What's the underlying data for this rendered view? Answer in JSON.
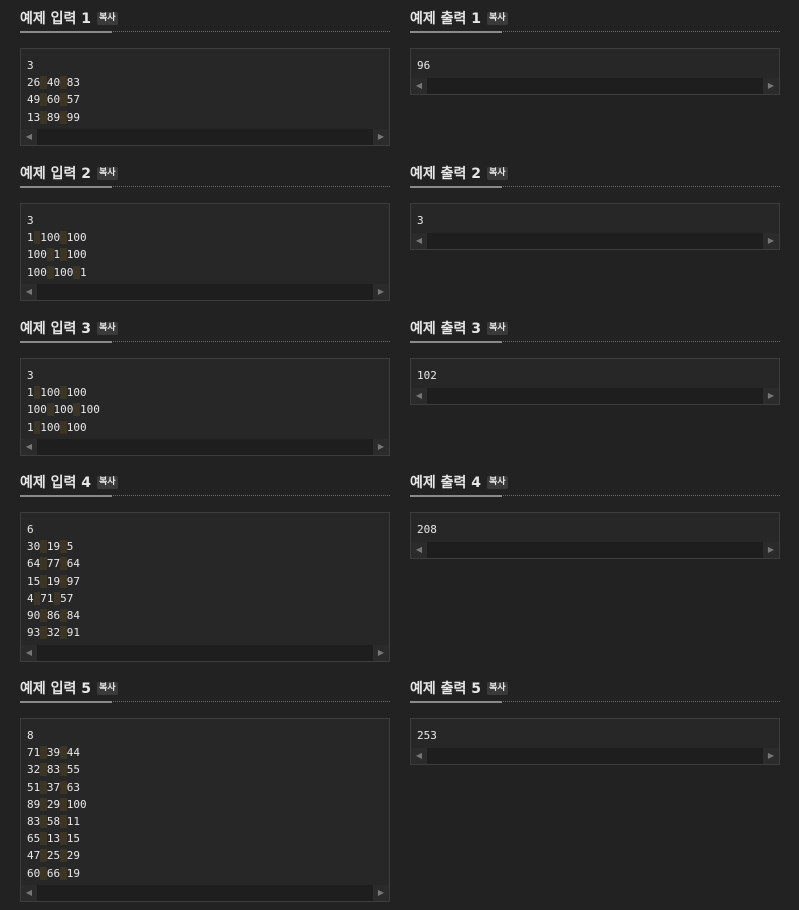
{
  "copy_label": "복사",
  "samples": [
    {
      "input_title": "예제 입력 1",
      "output_title": "예제 출력 1",
      "input_lines": [
        "3",
        [
          "26",
          "40",
          "83"
        ],
        [
          "49",
          "60",
          "57"
        ],
        [
          "13",
          "89",
          "99"
        ]
      ],
      "output": "96"
    },
    {
      "input_title": "예제 입력 2",
      "output_title": "예제 출력 2",
      "input_lines": [
        "3",
        [
          "1",
          "100",
          "100"
        ],
        [
          "100",
          "1",
          "100"
        ],
        [
          "100",
          "100",
          "1"
        ]
      ],
      "output": "3"
    },
    {
      "input_title": "예제 입력 3",
      "output_title": "예제 출력 3",
      "input_lines": [
        "3",
        [
          "1",
          "100",
          "100"
        ],
        [
          "100",
          "100",
          "100"
        ],
        [
          "1",
          "100",
          "100"
        ]
      ],
      "output": "102"
    },
    {
      "input_title": "예제 입력 4",
      "output_title": "예제 출력 4",
      "input_lines": [
        "6",
        [
          "30",
          "19",
          "5"
        ],
        [
          "64",
          "77",
          "64"
        ],
        [
          "15",
          "19",
          "97"
        ],
        [
          "4",
          "71",
          "57"
        ],
        [
          "90",
          "86",
          "84"
        ],
        [
          "93",
          "32",
          "91"
        ]
      ],
      "output": "208"
    },
    {
      "input_title": "예제 입력 5",
      "output_title": "예제 출력 5",
      "input_lines": [
        "8",
        [
          "71",
          "39",
          "44"
        ],
        [
          "32",
          "83",
          "55"
        ],
        [
          "51",
          "37",
          "63"
        ],
        [
          "89",
          "29",
          "100"
        ],
        [
          "83",
          "58",
          "11"
        ],
        [
          "65",
          "13",
          "15"
        ],
        [
          "47",
          "25",
          "29"
        ],
        [
          "60",
          "66",
          "19"
        ]
      ],
      "output": "253"
    }
  ],
  "scroll_left_glyph": "◀",
  "scroll_right_glyph": "▶"
}
